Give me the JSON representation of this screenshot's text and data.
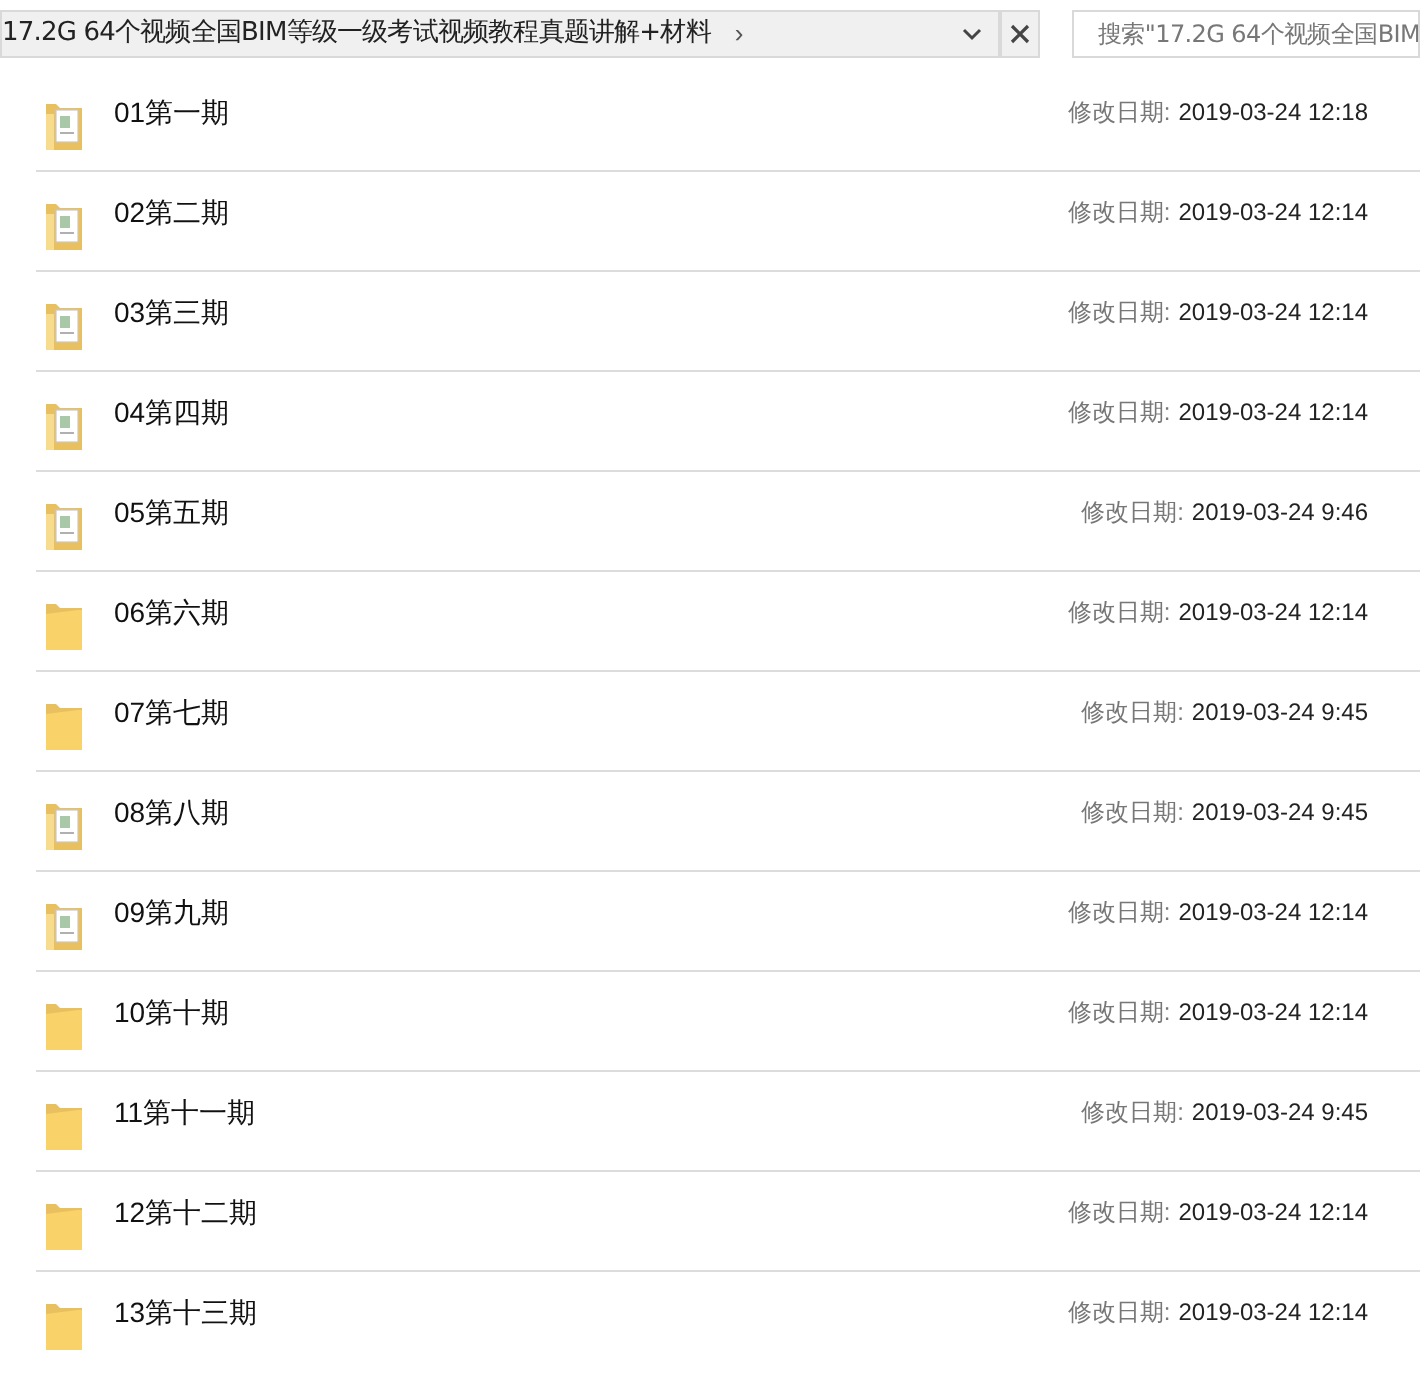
{
  "address_bar": {
    "path": "17.2G 64个视频全国BIM等级一级考试视频教程真题讲解+材料",
    "separator": "›"
  },
  "search": {
    "placeholder": "搜索\"17.2G 64个视频全国BIM"
  },
  "files": [
    {
      "name": "01第一期",
      "date_label": "修改日期:",
      "date": "2019-03-24 12:18",
      "kind": "docs"
    },
    {
      "name": "02第二期",
      "date_label": "修改日期:",
      "date": "2019-03-24 12:14",
      "kind": "docs"
    },
    {
      "name": "03第三期",
      "date_label": "修改日期:",
      "date": "2019-03-24 12:14",
      "kind": "docs"
    },
    {
      "name": "04第四期",
      "date_label": "修改日期:",
      "date": "2019-03-24 12:14",
      "kind": "docs"
    },
    {
      "name": "05第五期",
      "date_label": "修改日期:",
      "date": "2019-03-24 9:46",
      "kind": "docs"
    },
    {
      "name": "06第六期",
      "date_label": "修改日期:",
      "date": "2019-03-24 12:14",
      "kind": "plain"
    },
    {
      "name": "07第七期",
      "date_label": "修改日期:",
      "date": "2019-03-24 9:45",
      "kind": "plain"
    },
    {
      "name": "08第八期",
      "date_label": "修改日期:",
      "date": "2019-03-24 9:45",
      "kind": "docs"
    },
    {
      "name": "09第九期",
      "date_label": "修改日期:",
      "date": "2019-03-24 12:14",
      "kind": "docs"
    },
    {
      "name": "10第十期",
      "date_label": "修改日期:",
      "date": "2019-03-24 12:14",
      "kind": "plain"
    },
    {
      "name": "11第十一期",
      "date_label": "修改日期:",
      "date": "2019-03-24 9:45",
      "kind": "plain"
    },
    {
      "name": "12第十二期",
      "date_label": "修改日期:",
      "date": "2019-03-24 12:14",
      "kind": "plain"
    },
    {
      "name": "13第十三期",
      "date_label": "修改日期:",
      "date": "2019-03-24 12:14",
      "kind": "plain"
    }
  ]
}
